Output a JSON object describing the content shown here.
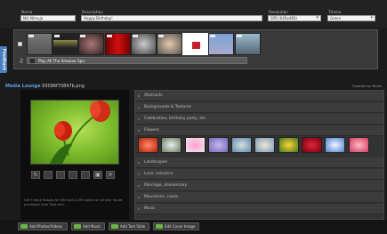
{
  "meta": {
    "name_label": "Name",
    "name_value": "Niti Nimuja",
    "description_label": "Description",
    "description_value": "Happy Birthday!",
    "resolution_label": "Resolution",
    "resolution_value": "SPD (640x480)",
    "theme_label": "Theme",
    "theme_value": "Green"
  },
  "feedback": "Feedback",
  "strip": {
    "music_label": "Play",
    "music_title": "All The Smoove Spa"
  },
  "lounge": {
    "title": "Media Lounge",
    "filename": "93096f70847b.png",
    "powered": "Powered by Media"
  },
  "tools": [
    "↻",
    "",
    "",
    "",
    "",
    "▣",
    "✕"
  ],
  "note": "Get 3 more images for free and a 25% bonus on all your future purchases from Tulip.com",
  "categories": [
    "Abstracts",
    "Backgrounds & Textures",
    "Celebration, birthday party, etc",
    "Flowers",
    "Landscapes",
    "Love, romance",
    "Marriage, anniversary",
    "Mountains, caves",
    "Music"
  ],
  "buttons": [
    "Add Photos/Videos",
    "Add Music",
    "Add Text Slide",
    "Edit Cover Image"
  ],
  "colors": {
    "accent_blue": "#5aa0e0",
    "feedback_blue": "#4d7fc0",
    "icon_green": "#6cb545"
  }
}
